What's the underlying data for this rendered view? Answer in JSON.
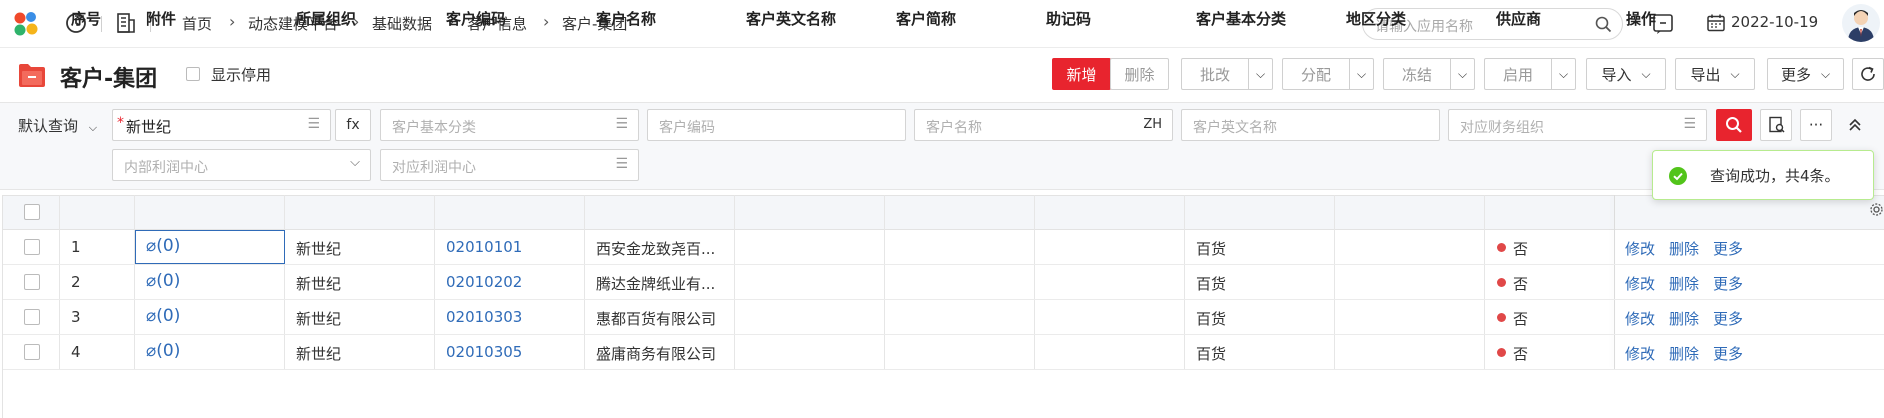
{
  "header": {
    "breadcrumb": [
      "首页",
      "动态建模平台",
      "基础数据",
      "客户信息",
      "客户-集团"
    ],
    "search_placeholder": "请输入应用名称",
    "date": "2022-10-19"
  },
  "titlebar": {
    "title": "客户-集团",
    "show_disabled_label": "显示停用",
    "buttons": {
      "add": "新增",
      "delete": "删除",
      "approve": "批改",
      "assign": "分配",
      "freeze": "冻结",
      "enable": "启用",
      "import": "导入",
      "export": "导出",
      "more": "更多"
    }
  },
  "filter": {
    "query_mode": "默认查询",
    "org_value": "新世纪",
    "fx": "fx",
    "basic_category_placeholder": "客户基本分类",
    "code_placeholder": "客户编码",
    "name_placeholder": "客户名称",
    "lang_tag": "ZH",
    "english_name_placeholder": "客户英文名称",
    "finance_org_placeholder": "对应财务组织",
    "profit_center_placeholder": "内部利润中心",
    "corr_profit_center_placeholder": "对应利润中心"
  },
  "toast": {
    "message": "查询成功，共4条。"
  },
  "table": {
    "columns": [
      "序号",
      "附件",
      "所属组织",
      "客户编码",
      "客户名称",
      "客户英文名称",
      "客户简称",
      "助记码",
      "客户基本分类",
      "地区分类",
      "供应商",
      "操作"
    ],
    "rows": [
      {
        "no": "1",
        "attach": "(0)",
        "org": "新世纪",
        "code": "02010101",
        "name": "西安金龙致尧百...",
        "en": "",
        "short": "",
        "mnemonic": "",
        "category": "百货",
        "region": "",
        "supplier": "否"
      },
      {
        "no": "2",
        "attach": "(0)",
        "org": "新世纪",
        "code": "02010202",
        "name": "腾达金牌纸业有...",
        "en": "",
        "short": "",
        "mnemonic": "",
        "category": "百货",
        "region": "",
        "supplier": "否"
      },
      {
        "no": "3",
        "attach": "(0)",
        "org": "新世纪",
        "code": "02010303",
        "name": "惠都百货有限公司",
        "en": "",
        "short": "",
        "mnemonic": "",
        "category": "百货",
        "region": "",
        "supplier": "否"
      },
      {
        "no": "4",
        "attach": "(0)",
        "org": "新世纪",
        "code": "02010305",
        "name": "盛庸商务有限公司",
        "en": "",
        "short": "",
        "mnemonic": "",
        "category": "百货",
        "region": "",
        "supplier": "否"
      }
    ],
    "actions": {
      "edit": "修改",
      "delete": "删除",
      "more": "更多"
    }
  },
  "colors": {
    "primary_red": "#e8242e",
    "link_blue": "#2f6bb8",
    "status_red": "#e04848",
    "success_green": "#52c41a"
  }
}
